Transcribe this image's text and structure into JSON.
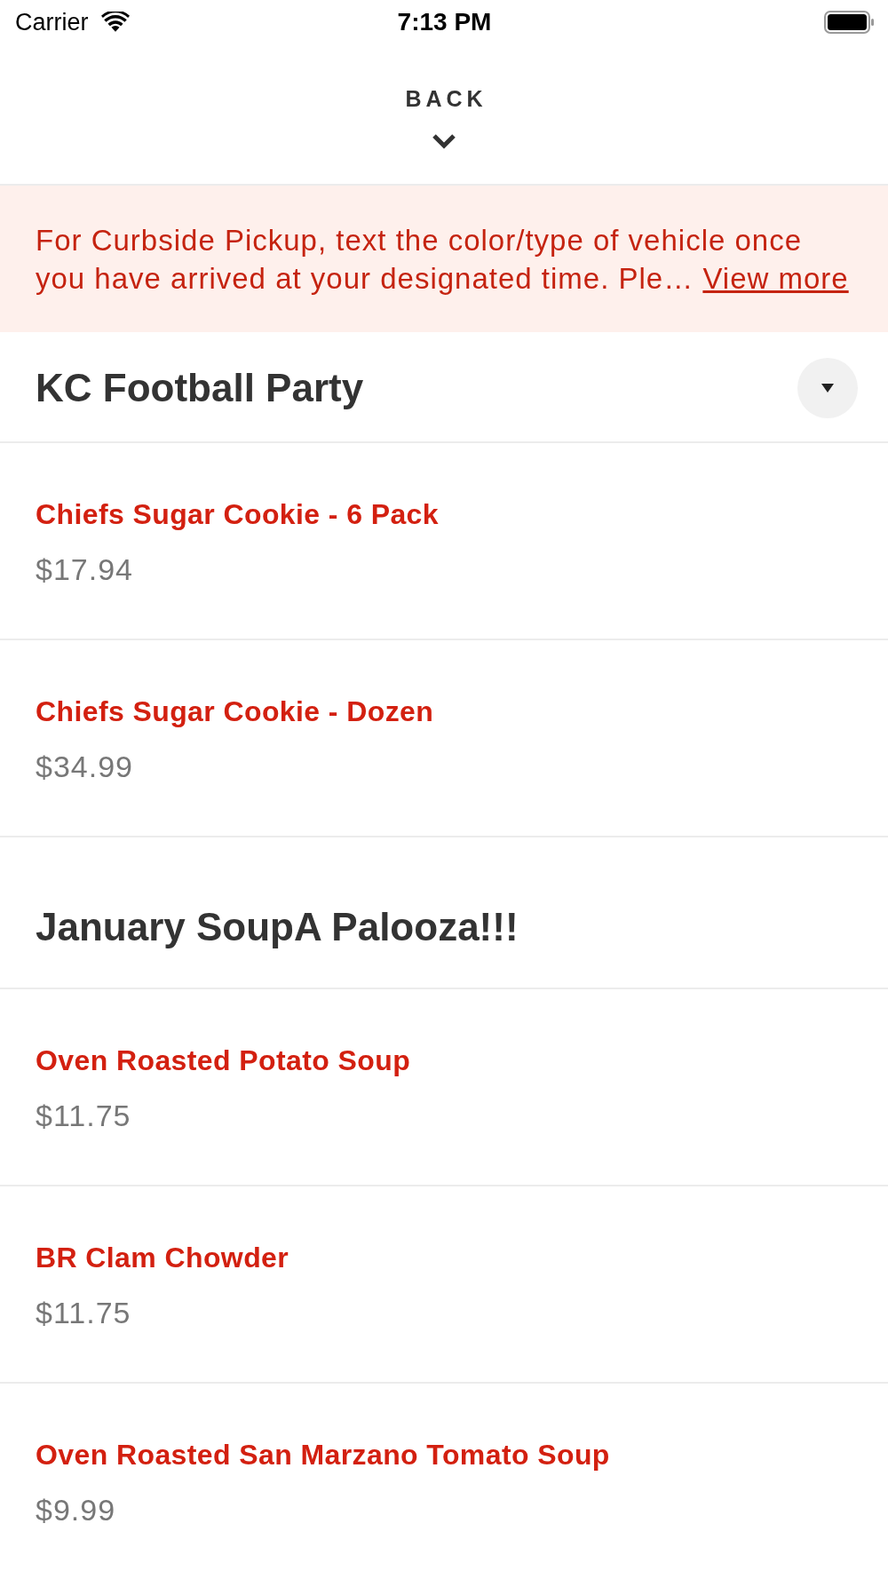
{
  "status_bar": {
    "carrier": "Carrier",
    "time": "7:13 PM"
  },
  "header": {
    "back_label": "BACK"
  },
  "notice": {
    "text": "For Curbside Pickup, text the color/type of vehicle once you have arrived at your designated time. Ple…",
    "link": "View more"
  },
  "sections": [
    {
      "title": "KC Football Party",
      "dropdown": true,
      "items": [
        {
          "name": "Chiefs Sugar Cookie - 6 Pack",
          "price": "$17.94"
        },
        {
          "name": "Chiefs Sugar Cookie - Dozen",
          "price": "$34.99"
        }
      ]
    },
    {
      "title": "January SoupA Palooza!!!",
      "dropdown": false,
      "items": [
        {
          "name": "Oven Roasted Potato Soup",
          "price": "$11.75"
        },
        {
          "name": "BR Clam Chowder",
          "price": "$11.75"
        },
        {
          "name": "Oven Roasted San Marzano Tomato Soup",
          "price": "$9.99"
        }
      ]
    }
  ]
}
